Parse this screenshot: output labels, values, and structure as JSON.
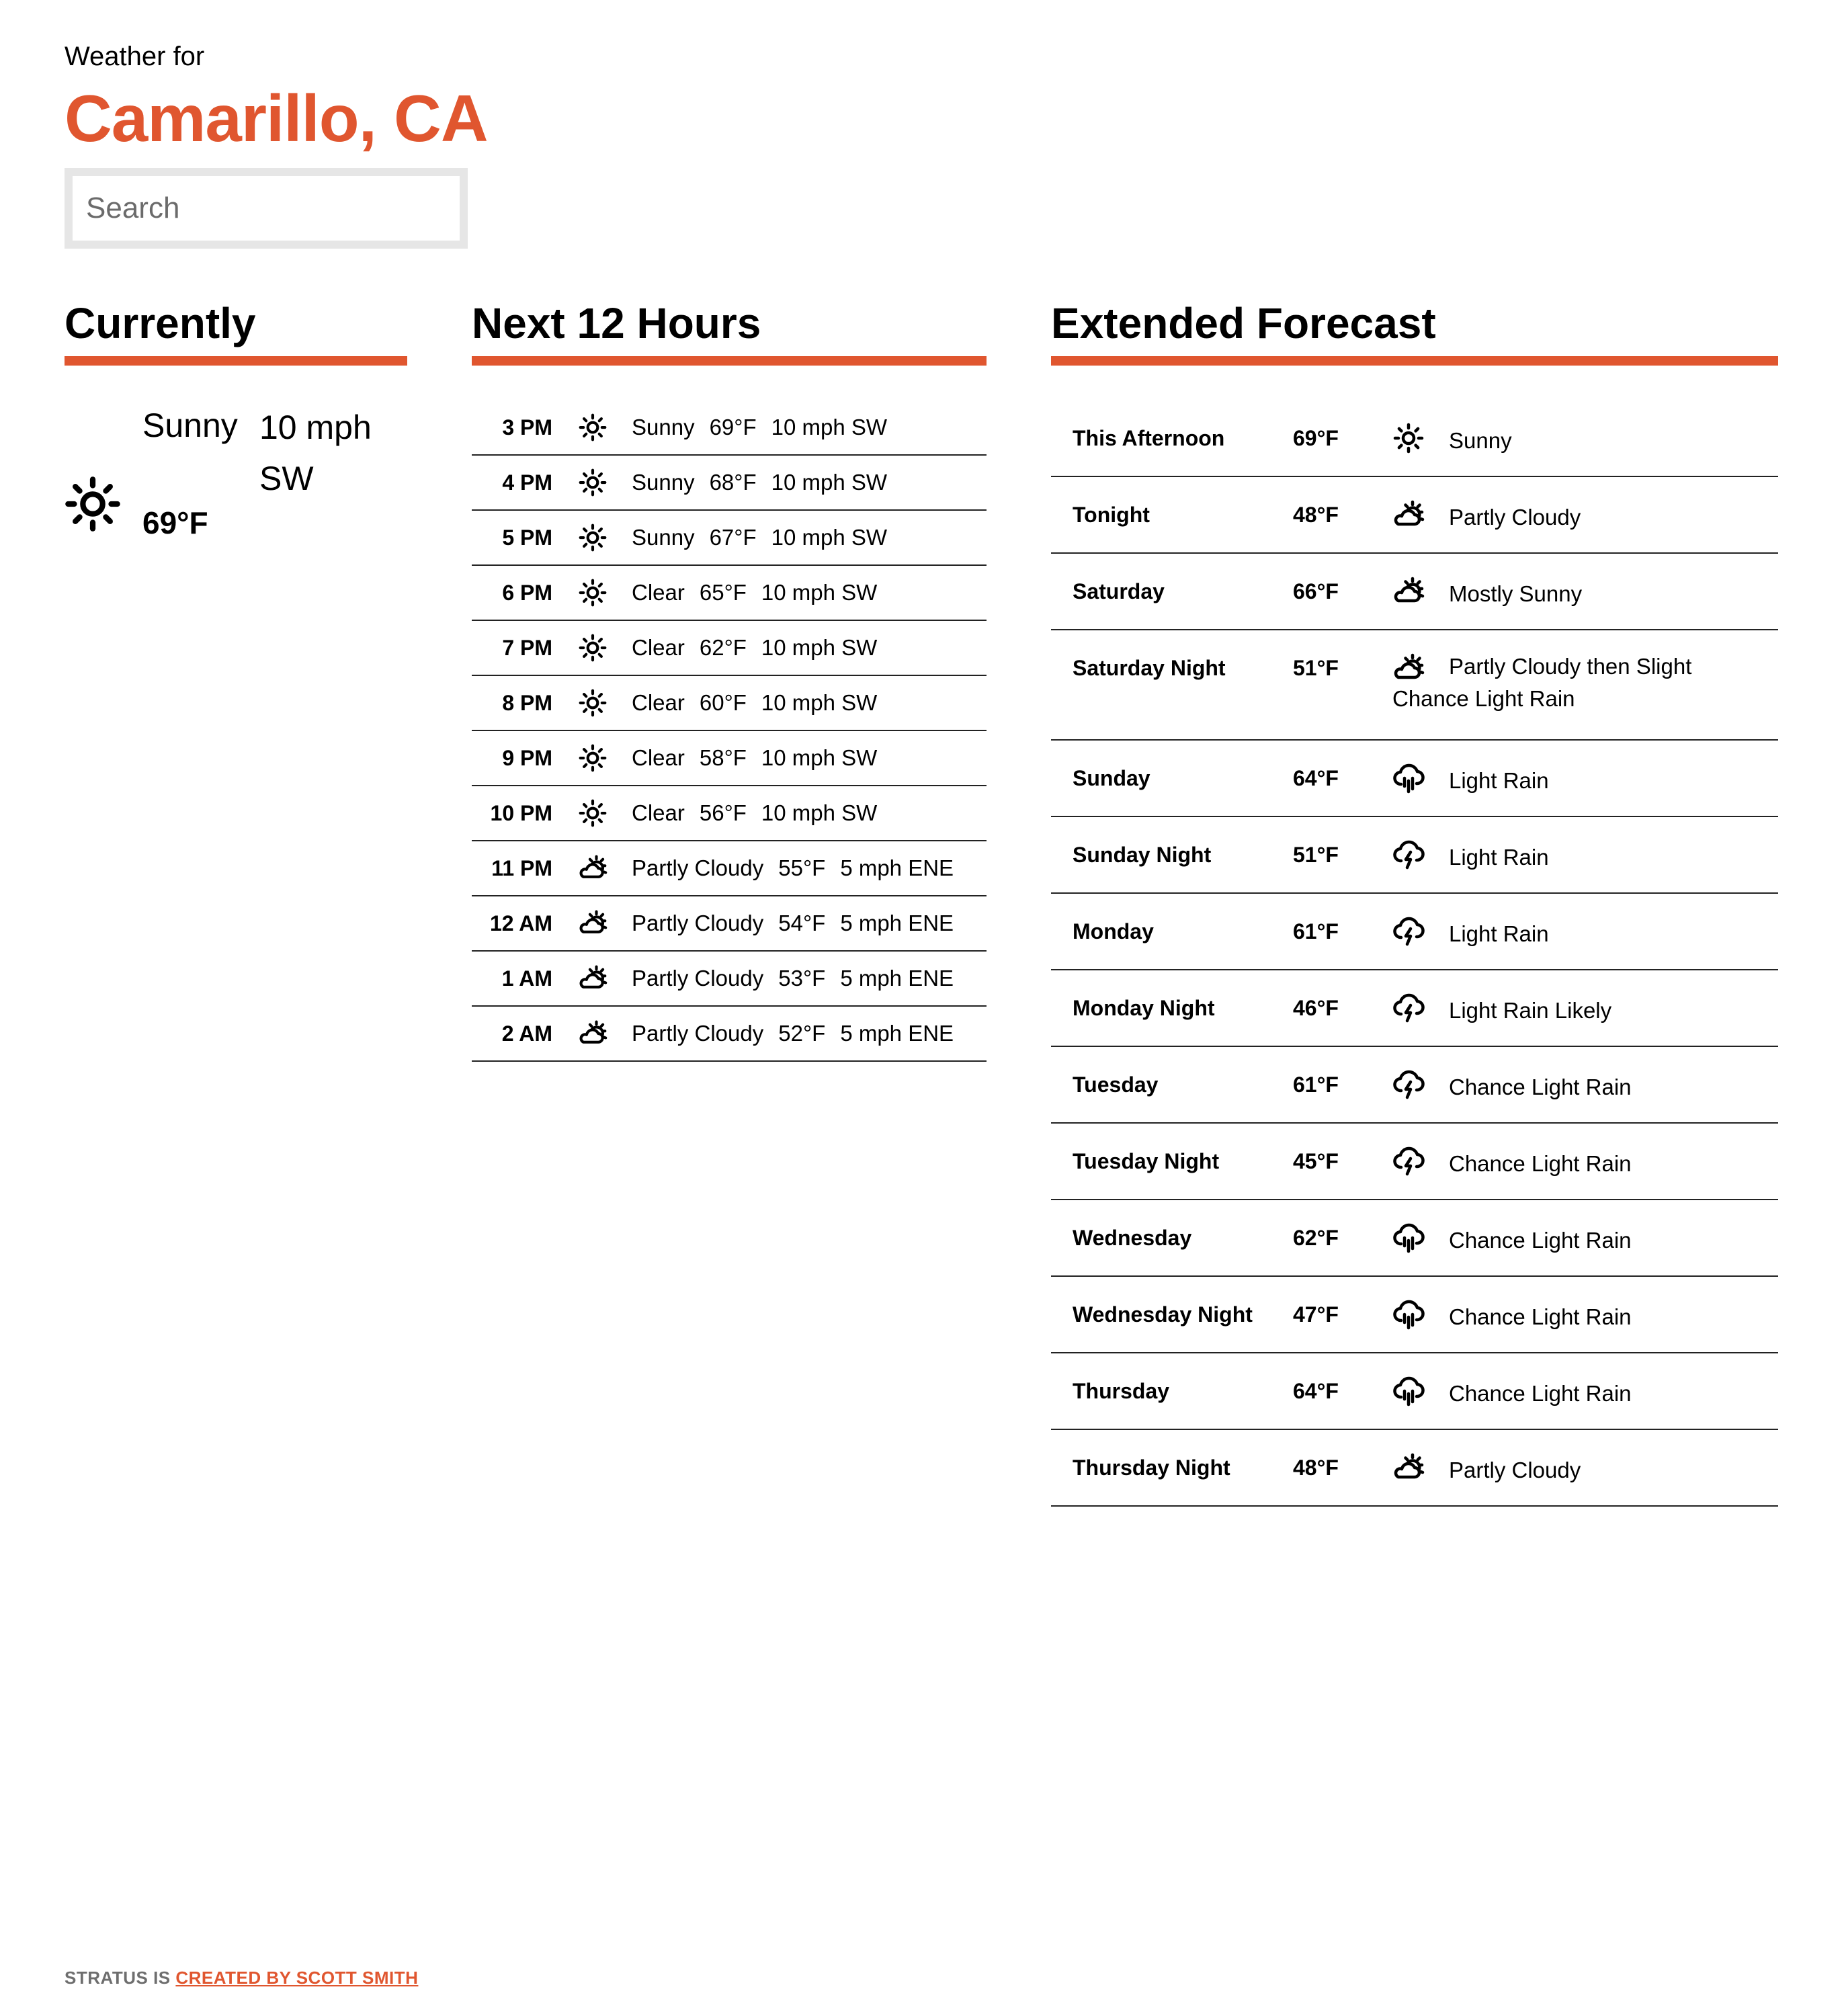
{
  "header": {
    "weather_for": "Weather for",
    "city": "Camarillo, CA",
    "search_placeholder": "Search"
  },
  "sections": {
    "currently": "Currently",
    "next12": "Next 12 Hours",
    "extended": "Extended Forecast"
  },
  "colors": {
    "accent": "#e0562f",
    "footer_text": "#6e6e6e"
  },
  "currently": {
    "condition": "Sunny",
    "wind": "10 mph SW",
    "temp": "69°F",
    "icon": "sun-icon"
  },
  "hourly": [
    {
      "time": "3 PM",
      "icon": "sun-icon",
      "cond": "Sunny",
      "temp": "69°F",
      "wind": "10 mph SW"
    },
    {
      "time": "4 PM",
      "icon": "sun-icon",
      "cond": "Sunny",
      "temp": "68°F",
      "wind": "10 mph SW"
    },
    {
      "time": "5 PM",
      "icon": "sun-icon",
      "cond": "Sunny",
      "temp": "67°F",
      "wind": "10 mph SW"
    },
    {
      "time": "6 PM",
      "icon": "sun-icon",
      "cond": "Clear",
      "temp": "65°F",
      "wind": "10 mph SW"
    },
    {
      "time": "7 PM",
      "icon": "sun-icon",
      "cond": "Clear",
      "temp": "62°F",
      "wind": "10 mph SW"
    },
    {
      "time": "8 PM",
      "icon": "sun-icon",
      "cond": "Clear",
      "temp": "60°F",
      "wind": "10 mph SW"
    },
    {
      "time": "9 PM",
      "icon": "sun-icon",
      "cond": "Clear",
      "temp": "58°F",
      "wind": "10 mph SW"
    },
    {
      "time": "10 PM",
      "icon": "sun-icon",
      "cond": "Clear",
      "temp": "56°F",
      "wind": "10 mph SW"
    },
    {
      "time": "11 PM",
      "icon": "partly-cloudy-icon",
      "cond": "Partly Cloudy",
      "temp": "55°F",
      "wind": "5 mph ENE"
    },
    {
      "time": "12 AM",
      "icon": "partly-cloudy-icon",
      "cond": "Partly Cloudy",
      "temp": "54°F",
      "wind": "5 mph ENE"
    },
    {
      "time": "1 AM",
      "icon": "partly-cloudy-icon",
      "cond": "Partly Cloudy",
      "temp": "53°F",
      "wind": "5 mph ENE"
    },
    {
      "time": "2 AM",
      "icon": "partly-cloudy-icon",
      "cond": "Partly Cloudy",
      "temp": "52°F",
      "wind": "5 mph ENE"
    }
  ],
  "extended": [
    {
      "day": "This Afternoon",
      "temp": "69°F",
      "icon": "sun-icon",
      "desc": "Sunny"
    },
    {
      "day": "Tonight",
      "temp": "48°F",
      "icon": "partly-cloudy-icon",
      "desc": "Partly Cloudy"
    },
    {
      "day": "Saturday",
      "temp": "66°F",
      "icon": "partly-cloudy-icon",
      "desc": "Mostly Sunny"
    },
    {
      "day": "Saturday Night",
      "temp": "51°F",
      "icon": "partly-cloudy-icon",
      "desc": "Partly Cloudy then Slight Chance Light Rain"
    },
    {
      "day": "Sunday",
      "temp": "64°F",
      "icon": "rain-icon",
      "desc": "Light Rain"
    },
    {
      "day": "Sunday Night",
      "temp": "51°F",
      "icon": "thunderstorm-icon",
      "desc": "Light Rain"
    },
    {
      "day": "Monday",
      "temp": "61°F",
      "icon": "thunderstorm-icon",
      "desc": "Light Rain"
    },
    {
      "day": "Monday Night",
      "temp": "46°F",
      "icon": "thunderstorm-icon",
      "desc": "Light Rain Likely"
    },
    {
      "day": "Tuesday",
      "temp": "61°F",
      "icon": "thunderstorm-icon",
      "desc": "Chance Light Rain"
    },
    {
      "day": "Tuesday Night",
      "temp": "45°F",
      "icon": "thunderstorm-icon",
      "desc": "Chance Light Rain"
    },
    {
      "day": "Wednesday",
      "temp": "62°F",
      "icon": "rain-icon",
      "desc": "Chance Light Rain"
    },
    {
      "day": "Wednesday Night",
      "temp": "47°F",
      "icon": "rain-icon",
      "desc": "Chance Light Rain"
    },
    {
      "day": "Thursday",
      "temp": "64°F",
      "icon": "rain-icon",
      "desc": "Chance Light Rain"
    },
    {
      "day": "Thursday Night",
      "temp": "48°F",
      "icon": "partly-cloudy-icon",
      "desc": "Partly Cloudy"
    }
  ],
  "footer": {
    "prefix": "STRATUS IS",
    "link": "CREATED BY SCOTT SMITH"
  }
}
